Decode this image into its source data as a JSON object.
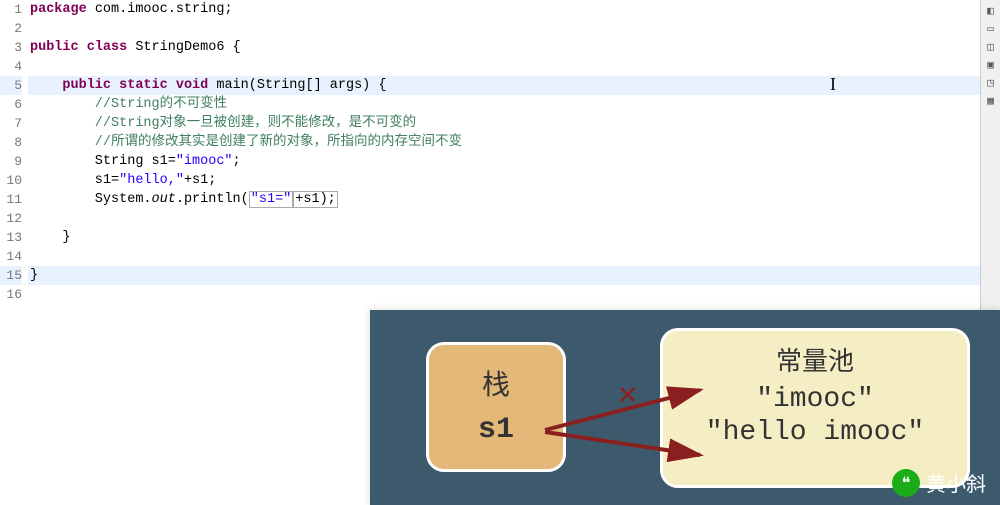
{
  "gutter": [
    "1",
    "2",
    "3",
    "4",
    "5",
    "6",
    "7",
    "8",
    "9",
    "10",
    "11",
    "12",
    "13",
    "14",
    "15",
    "16"
  ],
  "code": {
    "l1_kw": "package",
    "l1_rest": " com.imooc.string;",
    "l3_kw1": "public",
    "l3_kw2": "class",
    "l3_rest": " StringDemo6 {",
    "l5_kw1": "public",
    "l5_kw2": "static",
    "l5_kw3": "void",
    "l5_rest": " main(String[] args) {",
    "l6": "        //String的不可变性",
    "l7": "        //String对象一旦被创建，则不能修改，是不可变的",
    "l8": "        //所谓的修改其实是创建了新的对象，所指向的内存空间不变",
    "l9_a": "        String s1=",
    "l9_b": "\"imooc\"",
    "l9_c": ";",
    "l10_a": "        s1=",
    "l10_b": "\"hello,\"",
    "l10_c": "+s1;",
    "l11_a": "        System.",
    "l11_b": "out",
    "l11_c": ".println(",
    "l11_d": "\"s1=\"",
    "l11_e": "+s1);",
    "l13": "    }",
    "l15": "}"
  },
  "diagram": {
    "stack_title": "栈",
    "stack_var": "s1",
    "pool_title": "常量池",
    "pool_val1": "\"imooc\"",
    "pool_val2": "\"hello imooc\"",
    "cross": "✕"
  },
  "watermark": {
    "text": "黄小斜"
  }
}
